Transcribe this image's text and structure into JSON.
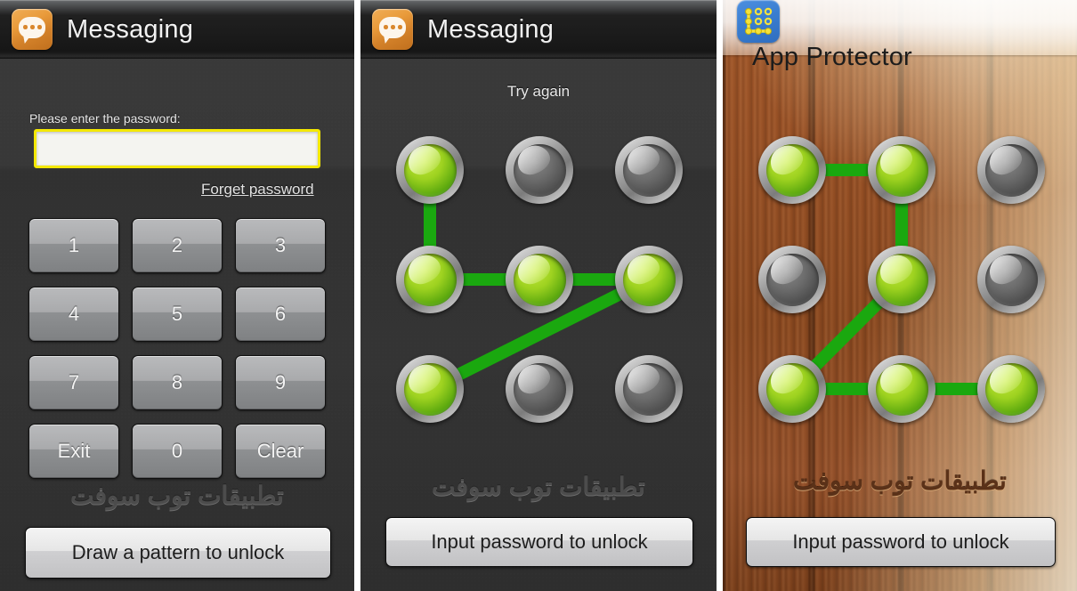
{
  "panels": [
    {
      "id": "password-panel",
      "titlebar": {
        "icon": "messaging-icon",
        "title": "Messaging"
      },
      "form": {
        "label": "Please enter the password:",
        "input_value": "",
        "input_placeholder": "",
        "forget_link": "Forget password"
      },
      "keypad": [
        "1",
        "2",
        "3",
        "4",
        "5",
        "6",
        "7",
        "8",
        "9",
        "Exit",
        "0",
        "Clear"
      ],
      "watermark": "تطبيقات توب سوفت",
      "bottom_button": "Draw a pattern to unlock"
    },
    {
      "id": "pattern-retry-panel",
      "titlebar": {
        "icon": "messaging-icon",
        "title": "Messaging"
      },
      "status": "Try again",
      "pattern": {
        "dots_state": [
          "on",
          "off",
          "off",
          "on",
          "on",
          "on",
          "on",
          "off",
          "off"
        ],
        "path": [
          0,
          3,
          4,
          5,
          6
        ]
      },
      "watermark": "تطبيقات توب سوفت",
      "bottom_button": "Input password to unlock"
    },
    {
      "id": "app-protector-panel",
      "titlebar": {
        "icon": "app-protector-icon",
        "title": "App Protector"
      },
      "status": "",
      "pattern": {
        "dots_state": [
          "on",
          "on",
          "off",
          "off",
          "on",
          "off",
          "on",
          "on",
          "on"
        ],
        "path": [
          0,
          1,
          4,
          6,
          7,
          8
        ]
      },
      "watermark": "تطبيقات توب سوفت",
      "bottom_button": "Input password to unlock"
    }
  ],
  "colors": {
    "accent_yellow": "#f4e800",
    "pattern_green": "#1aa80f",
    "dot_on": "#9ed220",
    "dot_off": "#6d6d6d",
    "messaging_orange": "#e99b3b",
    "protector_blue": "#3b7ed0",
    "wood_brown": "#8e4e22"
  }
}
